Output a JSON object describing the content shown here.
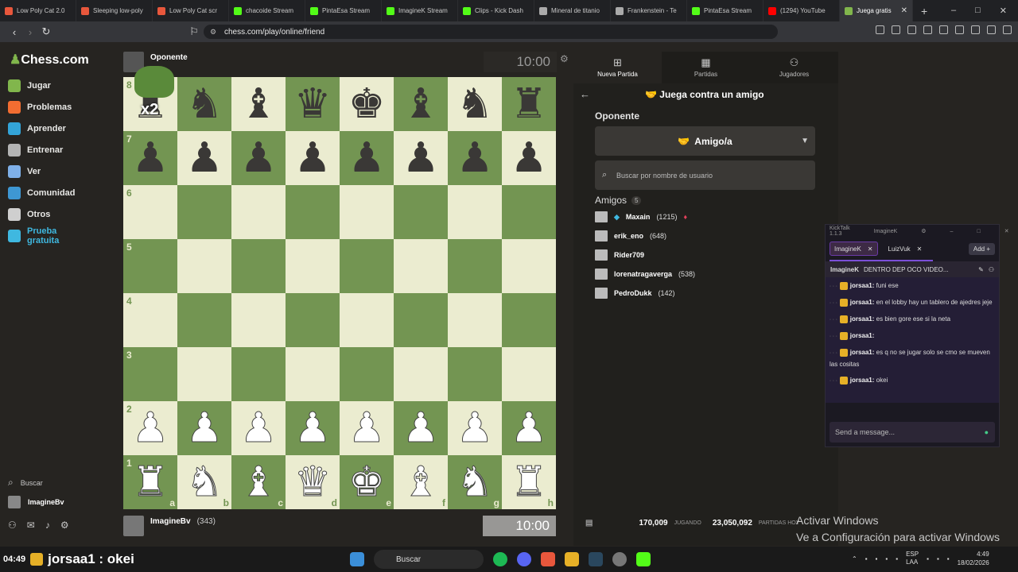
{
  "browser": {
    "tabs": [
      {
        "label": "Low Poly Cat 2.0",
        "color": "#e8573c"
      },
      {
        "label": "Sleeping low-poly",
        "color": "#e8573c"
      },
      {
        "label": "Low Poly Cat scr",
        "color": "#e8573c"
      },
      {
        "label": "chacoide Stream",
        "color": "#53fc18"
      },
      {
        "label": "PintaEsa Stream",
        "color": "#53fc18"
      },
      {
        "label": "ImagineK Stream",
        "color": "#53fc18"
      },
      {
        "label": "Clips - Kick Dash",
        "color": "#53fc18"
      },
      {
        "label": "Mineral de titanio",
        "color": "#aaaaaa"
      },
      {
        "label": "Frankenstein - Te",
        "color": "#aaaaaa"
      },
      {
        "label": "PintaEsa Stream",
        "color": "#53fc18"
      },
      {
        "label": "(1294) YouTube",
        "color": "#ff0000"
      },
      {
        "label": "Juega gratis",
        "color": "#81b64c",
        "active": true
      }
    ],
    "url": "chess.com/play/online/friend"
  },
  "sidebar": {
    "logo": "Chess.com",
    "items": [
      {
        "label": "Jugar",
        "color": "#81b64c"
      },
      {
        "label": "Problemas",
        "color": "#f26d31"
      },
      {
        "label": "Aprender",
        "color": "#33a4d8"
      },
      {
        "label": "Entrenar",
        "color": "#b4b4b4"
      },
      {
        "label": "Ver",
        "color": "#7fb0e8"
      },
      {
        "label": "Comunidad",
        "color": "#3e97d3"
      },
      {
        "label": "Otros",
        "color": "#cfcfcf"
      },
      {
        "label": "Prueba gratuita",
        "color": "#3fb8e0"
      }
    ],
    "search_label": "Buscar",
    "user_label": "ImagineBv"
  },
  "game": {
    "opponent_name": "Oponente",
    "opponent_clock": "10:00",
    "player_name": "ImagineBv",
    "player_rating": "(343)",
    "player_clock": "10:00",
    "overlay_text": "x2",
    "ranks": [
      "8",
      "7",
      "6",
      "5",
      "4",
      "3",
      "2",
      "1"
    ],
    "files": [
      "a",
      "b",
      "c",
      "d",
      "e",
      "f",
      "g",
      "h"
    ],
    "position": [
      [
        "r",
        "n",
        "b",
        "q",
        "k",
        "b",
        "n",
        "r"
      ],
      [
        "p",
        "p",
        "p",
        "p",
        "p",
        "p",
        "p",
        "p"
      ],
      [
        "",
        "",
        "",
        "",
        "",
        "",
        "",
        ""
      ],
      [
        "",
        "",
        "",
        "",
        "",
        "",
        "",
        ""
      ],
      [
        "",
        "",
        "",
        "",
        "",
        "",
        "",
        ""
      ],
      [
        "",
        "",
        "",
        "",
        "",
        "",
        "",
        ""
      ],
      [
        "P",
        "P",
        "P",
        "P",
        "P",
        "P",
        "P",
        "P"
      ],
      [
        "R",
        "N",
        "B",
        "Q",
        "K",
        "B",
        "N",
        "R"
      ]
    ]
  },
  "panel": {
    "tabs": [
      "Nueva Partida",
      "Partidas",
      "Jugadores"
    ],
    "title": "Juega contra un amigo",
    "opponent_label": "Oponente",
    "friend_select": "Amigo/a",
    "search_placeholder": "Buscar por nombre de usuario",
    "friends_label": "Amigos",
    "friends_count": "5",
    "friends": [
      {
        "name": "Maxain",
        "rating": "(1215)"
      },
      {
        "name": "erik_eno",
        "rating": "(648)"
      },
      {
        "name": "Rider709",
        "rating": ""
      },
      {
        "name": "lorenatragaverga",
        "rating": "(538)"
      },
      {
        "name": "PedroDukk",
        "rating": "(142)"
      }
    ],
    "stat_playing": "170,009",
    "stat_playing_label": "JUGANDO",
    "stat_games": "23,050,092",
    "stat_games_label": "PARTIDAS HOY"
  },
  "windows_watermark": {
    "line1": "Activar Windows",
    "line2": "Ve a Configuración para activar Windows"
  },
  "kicktalk": {
    "title": "KickTalk 1.1.3",
    "user": "ImagineK",
    "tabs": [
      "ImagineK",
      "LuizVuk"
    ],
    "add_label": "Add",
    "channel_title": "ImagineK",
    "channel_desc": "DENTRO DEP OCO VIDEO...",
    "messages": [
      {
        "user": "jorsaa1:",
        "text": "funi ese"
      },
      {
        "user": "jorsaa1:",
        "text": "en el lobby hay un tablero de ajedres jeje"
      },
      {
        "user": "jorsaa1:",
        "text": "es bien gore ese si la neta"
      },
      {
        "user": "jorsaa1:",
        "text": ""
      },
      {
        "user": "jorsaa1:",
        "text": "es q no se jugar solo se cmo se mueven las cositas"
      },
      {
        "user": "jorsaa1:",
        "text": "okei"
      }
    ],
    "input_placeholder": "Send a message..."
  },
  "stream": {
    "time": "04:49",
    "message": "jorsaa1 : okei"
  },
  "taskbar": {
    "search_label": "Buscar",
    "lang": "ESP",
    "region": "LAA",
    "time": "4:49",
    "date": "18/02/2026"
  }
}
